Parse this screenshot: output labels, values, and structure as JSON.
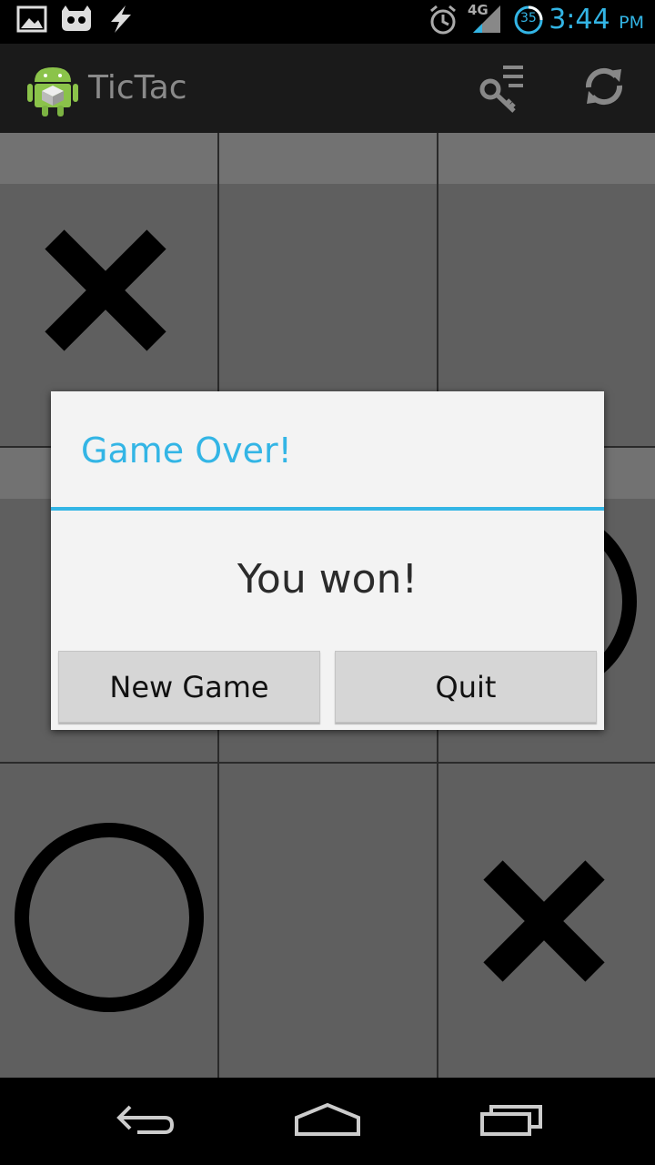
{
  "status_bar": {
    "time": "3:44",
    "ampm": "PM",
    "network": "4G",
    "battery": "35",
    "accent": "#33b5e5"
  },
  "action_bar": {
    "title": "TicTac",
    "app_icon": "android-icon",
    "actions": [
      "key-menu-icon",
      "refresh-icon"
    ]
  },
  "board": {
    "cells": [
      "X",
      "",
      "",
      "",
      "",
      "O",
      "O",
      "",
      "X"
    ]
  },
  "dialog": {
    "title": "Game Over!",
    "message": "You won!",
    "buttons": {
      "new_game": "New Game",
      "quit": "Quit"
    }
  },
  "nav_bar": {
    "buttons": [
      "back-icon",
      "home-icon",
      "recent-apps-icon"
    ]
  }
}
